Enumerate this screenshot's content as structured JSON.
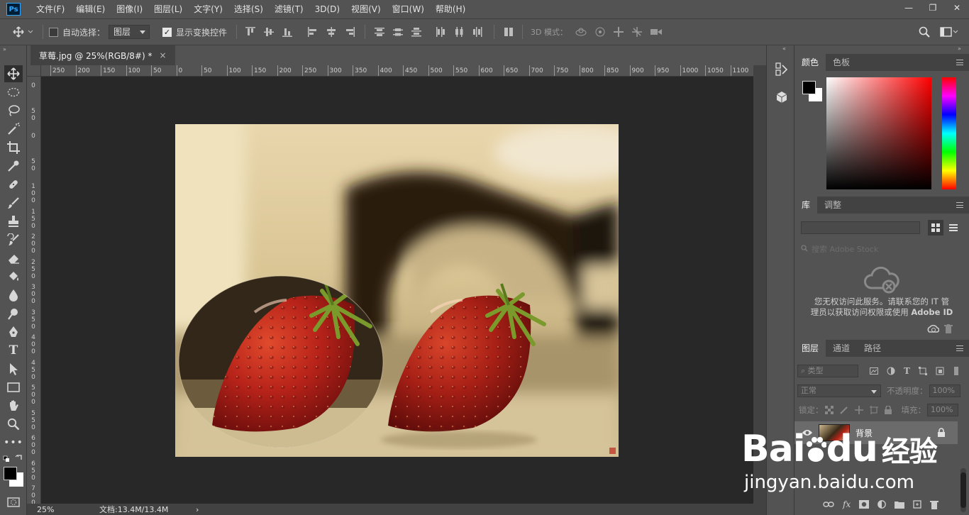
{
  "app": {
    "logo": "Ps",
    "menus": [
      "文件(F)",
      "编辑(E)",
      "图像(I)",
      "图层(L)",
      "文字(Y)",
      "选择(S)",
      "滤镜(T)",
      "3D(D)",
      "视图(V)",
      "窗口(W)",
      "帮助(H)"
    ],
    "window_controls": {
      "minimize": "—",
      "restore": "❐",
      "close": "✕"
    }
  },
  "options": {
    "auto_select_label": "自动选择：",
    "auto_select_checked": false,
    "auto_select_target": "图层",
    "show_transform_label": "显示变换控件",
    "show_transform_checked": true,
    "mode_3d_label": "3D 模式："
  },
  "document": {
    "tab_title": "草莓.jpg @ 25%(RGB/8#) *",
    "close": "×",
    "ruler_h": [
      "250",
      "200",
      "150",
      "100",
      "50",
      "0",
      "50",
      "100",
      "150",
      "200",
      "250",
      "300",
      "350",
      "400",
      "450",
      "500",
      "550",
      "600",
      "650",
      "700",
      "750",
      "800",
      "850",
      "900",
      "950",
      "1000",
      "1050",
      "1100"
    ],
    "ruler_v": [
      "0",
      "5 0",
      "0",
      "5 0",
      "1 0 0",
      "1 5 0",
      "2 0 0",
      "2 5 0",
      "3 0 0",
      "3 5 0",
      "4 0 0",
      "4 5 0",
      "5 0 0",
      "5 5 0",
      "6 0 0",
      "6 5 0",
      "7 0 0"
    ]
  },
  "status": {
    "zoom": "25%",
    "doc_size": "文档:13.4M/13.4M",
    "arrow": "›"
  },
  "panels": {
    "color": {
      "tabs": [
        "颜色",
        "色板"
      ],
      "foreground": "#000000",
      "background": "#ffffff",
      "hue": "#ff0000"
    },
    "library": {
      "tabs": [
        "库",
        "调整"
      ],
      "search_placeholder": "搜索 Adobe Stock",
      "message_line1": "您无权访问此服务。请联系您的 IT 管",
      "message_line2": "理员以获取访问权限或使用",
      "message_bold": "Adobe ID"
    },
    "layers": {
      "tabs": [
        "图层",
        "通道",
        "路径"
      ],
      "filter_label": "类型",
      "blend_mode": "正常",
      "opacity_label": "不透明度：",
      "opacity_value": "100%",
      "lock_label": "锁定：",
      "fill_label": "填充：",
      "fill_value": "100%",
      "items": [
        {
          "name": "背景",
          "locked": true,
          "visible": true
        }
      ],
      "footer_fx": "fx"
    }
  },
  "watermark": {
    "brand_a": "Bai",
    "brand_b": "du",
    "brand_c": "经验",
    "url": "jingyan.baidu.com"
  }
}
